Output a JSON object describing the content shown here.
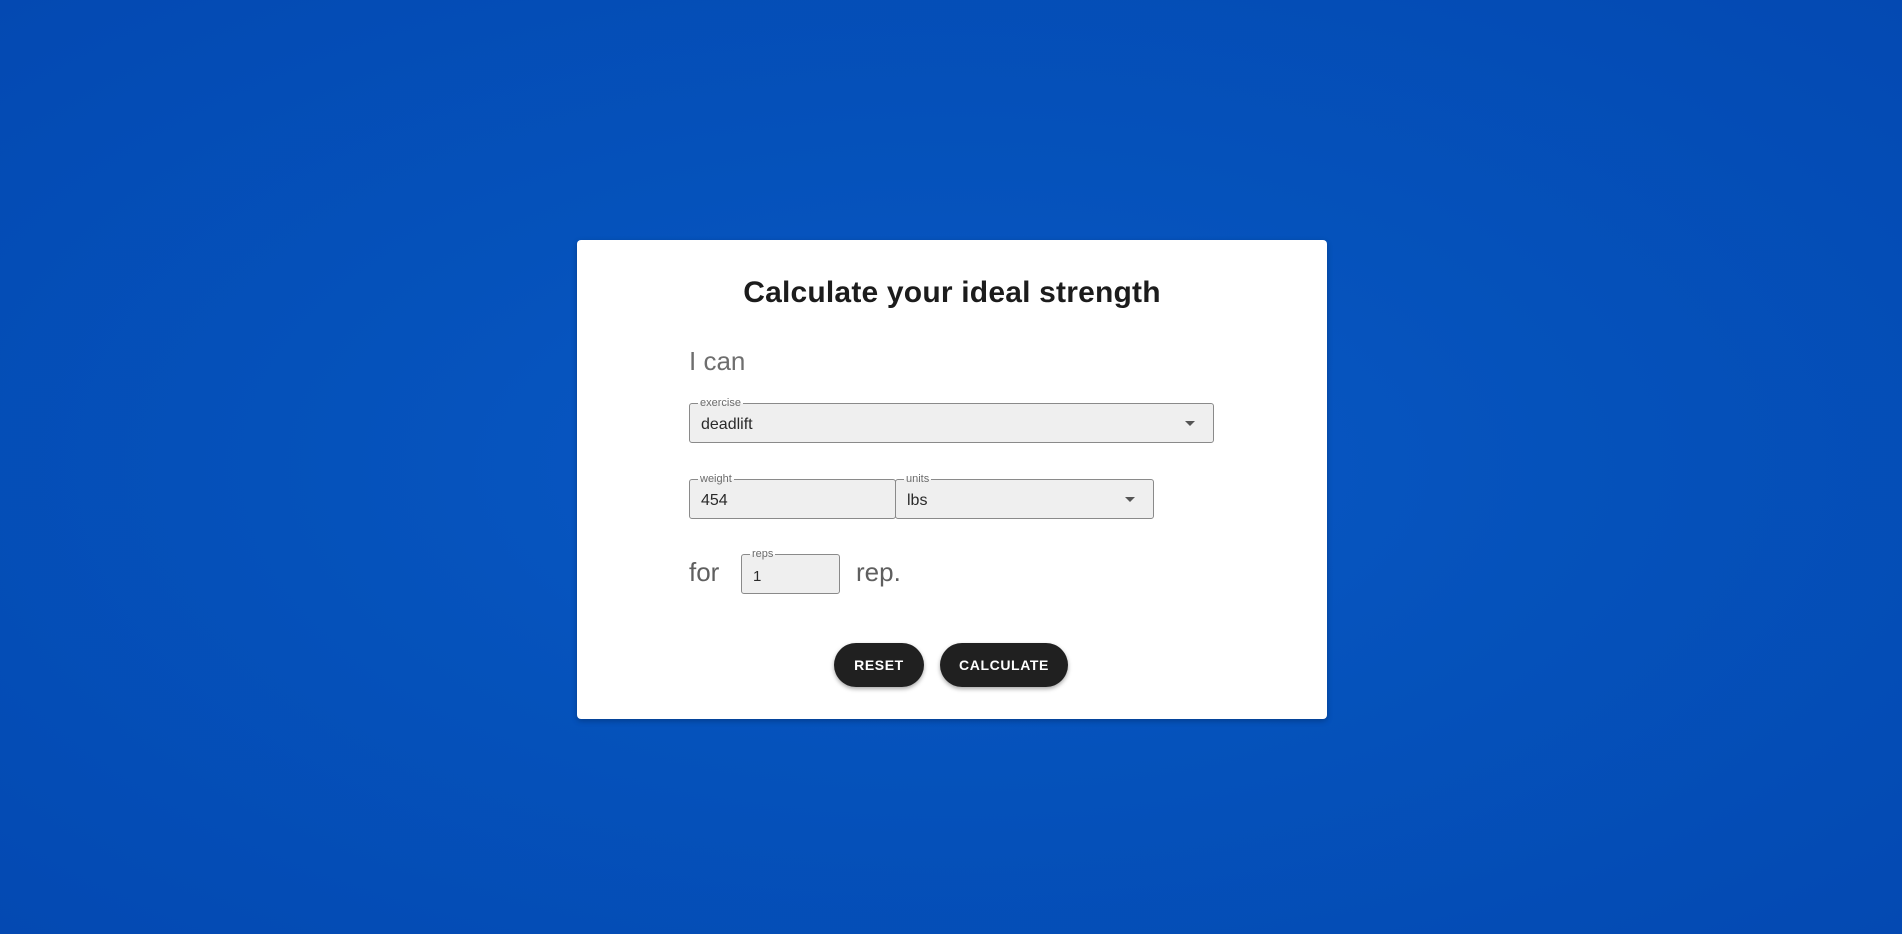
{
  "card": {
    "title": "Calculate your ideal strength",
    "lead_text": "I can"
  },
  "exercise": {
    "label": "exercise",
    "value": "deadlift",
    "icon": "caret-down-icon"
  },
  "weight": {
    "label": "weight",
    "value": "454"
  },
  "units": {
    "label": "units",
    "value": "lbs",
    "icon": "caret-down-icon"
  },
  "reps_row": {
    "prefix": "for",
    "reps_label": "reps",
    "reps_value": "1",
    "suffix": "rep."
  },
  "buttons": {
    "reset_label": "RESET",
    "calculate_label": "CALCULATE"
  },
  "colors": {
    "background": "#0552bb",
    "card": "#ffffff",
    "button": "#202020",
    "field_fill": "#efefef"
  }
}
